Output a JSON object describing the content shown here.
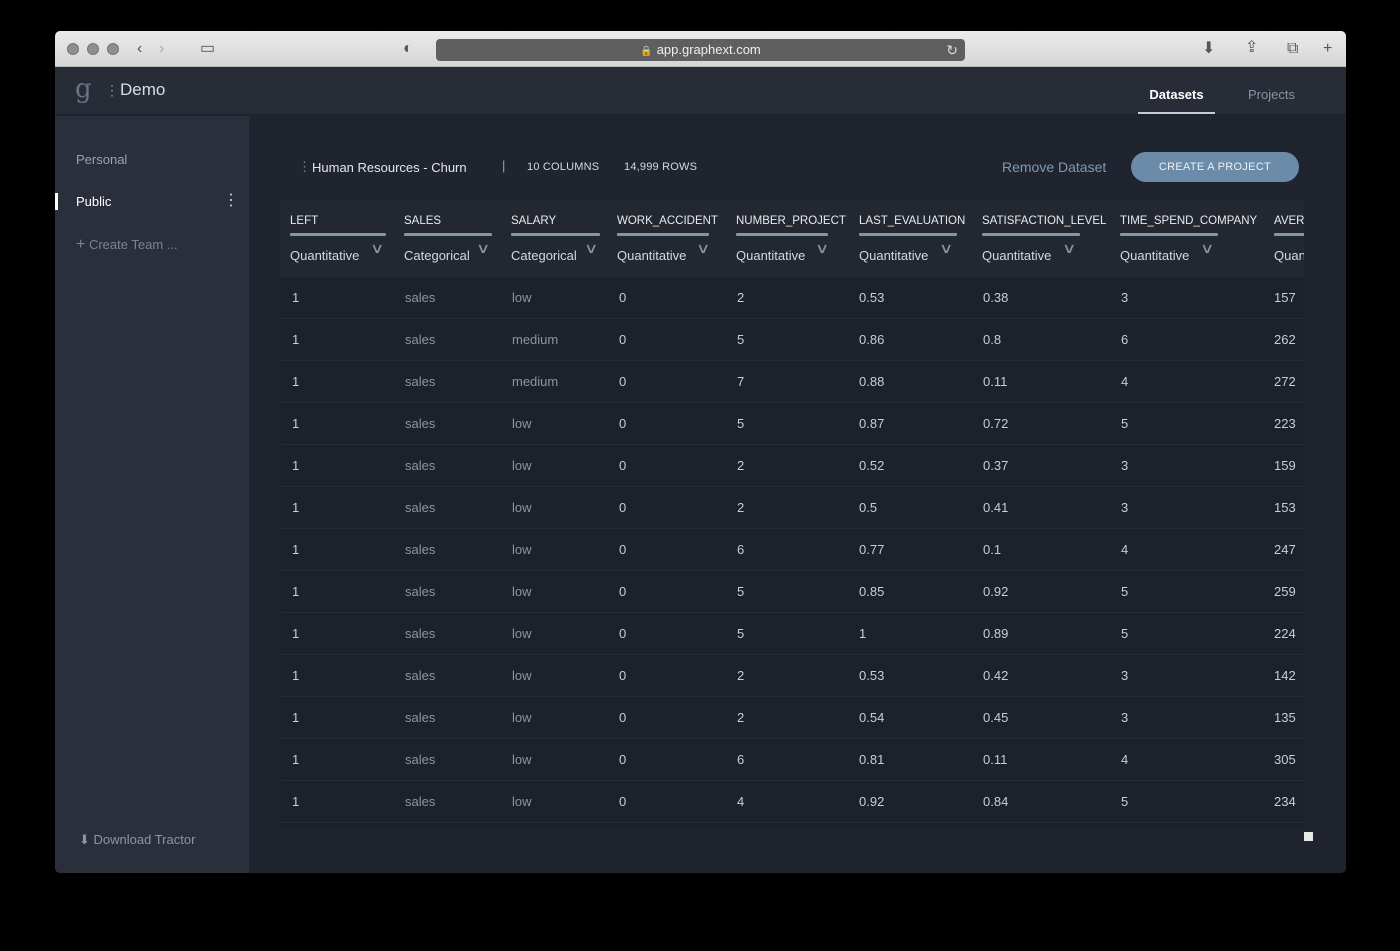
{
  "browser": {
    "url": "app.graphext.com"
  },
  "header": {
    "logo": "g",
    "org_name": "Demo",
    "tabs": [
      {
        "label": "Datasets",
        "active": true
      },
      {
        "label": "Projects",
        "active": false
      }
    ]
  },
  "sidebar": {
    "items": [
      {
        "label": "Personal"
      },
      {
        "label": "Public"
      }
    ],
    "create_team": "Create Team ...",
    "download": "Download Tractor"
  },
  "dataset": {
    "name": "Human Resources - Churn",
    "columns_count": "10 COLUMNS",
    "rows_count": "14,999 ROWS",
    "remove_label": "Remove Dataset",
    "create_project_label": "CREATE A PROJECT"
  },
  "table": {
    "columns": [
      {
        "name": "LEFT",
        "type": "Quantitative"
      },
      {
        "name": "SALES",
        "type": "Categorical"
      },
      {
        "name": "SALARY",
        "type": "Categorical"
      },
      {
        "name": "WORK_ACCIDENT",
        "type": "Quantitative"
      },
      {
        "name": "NUMBER_PROJECT",
        "type": "Quantitative"
      },
      {
        "name": "LAST_EVALUATION",
        "type": "Quantitative"
      },
      {
        "name": "SATISFACTION_LEVEL",
        "type": "Quantitative"
      },
      {
        "name": "TIME_SPEND_COMPANY",
        "type": "Quantitative"
      },
      {
        "name": "AVER",
        "type": "Quan"
      }
    ],
    "rows": [
      [
        "1",
        "sales",
        "low",
        "0",
        "2",
        "0.53",
        "0.38",
        "3",
        "157"
      ],
      [
        "1",
        "sales",
        "medium",
        "0",
        "5",
        "0.86",
        "0.8",
        "6",
        "262"
      ],
      [
        "1",
        "sales",
        "medium",
        "0",
        "7",
        "0.88",
        "0.11",
        "4",
        "272"
      ],
      [
        "1",
        "sales",
        "low",
        "0",
        "5",
        "0.87",
        "0.72",
        "5",
        "223"
      ],
      [
        "1",
        "sales",
        "low",
        "0",
        "2",
        "0.52",
        "0.37",
        "3",
        "159"
      ],
      [
        "1",
        "sales",
        "low",
        "0",
        "2",
        "0.5",
        "0.41",
        "3",
        "153"
      ],
      [
        "1",
        "sales",
        "low",
        "0",
        "6",
        "0.77",
        "0.1",
        "4",
        "247"
      ],
      [
        "1",
        "sales",
        "low",
        "0",
        "5",
        "0.85",
        "0.92",
        "5",
        "259"
      ],
      [
        "1",
        "sales",
        "low",
        "0",
        "5",
        "1",
        "0.89",
        "5",
        "224"
      ],
      [
        "1",
        "sales",
        "low",
        "0",
        "2",
        "0.53",
        "0.42",
        "3",
        "142"
      ],
      [
        "1",
        "sales",
        "low",
        "0",
        "2",
        "0.54",
        "0.45",
        "3",
        "135"
      ],
      [
        "1",
        "sales",
        "low",
        "0",
        "6",
        "0.81",
        "0.11",
        "4",
        "305"
      ],
      [
        "1",
        "sales",
        "low",
        "0",
        "4",
        "0.92",
        "0.84",
        "5",
        "234"
      ]
    ]
  },
  "colors": {
    "accent": "#6b8ba9",
    "background": "#20242e",
    "sidebar": "#2a2f3b"
  }
}
